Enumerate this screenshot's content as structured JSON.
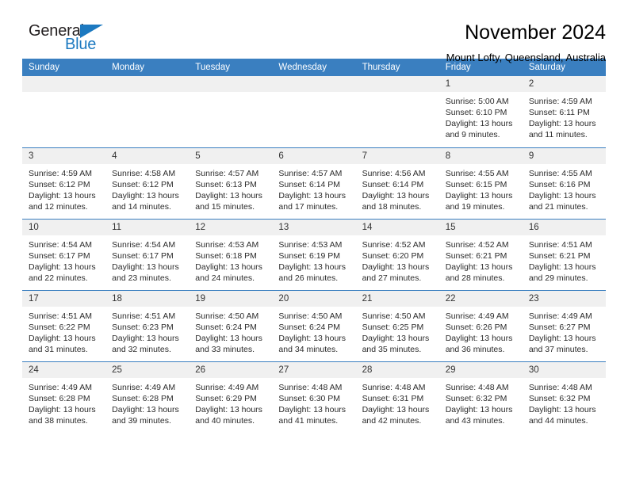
{
  "brand": {
    "name_top": "General",
    "name_bottom": "Blue",
    "accent_color": "#1c79c0",
    "triangle_icon": "brand-triangle-icon"
  },
  "header": {
    "title": "November 2024",
    "subtitle": "Mount Lofty, Queensland, Australia"
  },
  "colors": {
    "header_row_bg": "#3a7fc0",
    "header_row_text": "#ffffff",
    "daynum_bg": "#f0f0f0",
    "row_divider": "#3a7fc0"
  },
  "weekday_headers": [
    "Sunday",
    "Monday",
    "Tuesday",
    "Wednesday",
    "Thursday",
    "Friday",
    "Saturday"
  ],
  "labels": {
    "sunrise_prefix": "Sunrise:",
    "sunset_prefix": "Sunset:",
    "daylight_prefix": "Daylight:"
  },
  "weeks": [
    [
      {
        "day": "",
        "empty": true
      },
      {
        "day": "",
        "empty": true
      },
      {
        "day": "",
        "empty": true
      },
      {
        "day": "",
        "empty": true
      },
      {
        "day": "",
        "empty": true
      },
      {
        "day": "1",
        "sunrise": "Sunrise: 5:00 AM",
        "sunset": "Sunset: 6:10 PM",
        "daylight_line1": "Daylight: 13 hours",
        "daylight_line2": "and 9 minutes."
      },
      {
        "day": "2",
        "sunrise": "Sunrise: 4:59 AM",
        "sunset": "Sunset: 6:11 PM",
        "daylight_line1": "Daylight: 13 hours",
        "daylight_line2": "and 11 minutes."
      }
    ],
    [
      {
        "day": "3",
        "sunrise": "Sunrise: 4:59 AM",
        "sunset": "Sunset: 6:12 PM",
        "daylight_line1": "Daylight: 13 hours",
        "daylight_line2": "and 12 minutes."
      },
      {
        "day": "4",
        "sunrise": "Sunrise: 4:58 AM",
        "sunset": "Sunset: 6:12 PM",
        "daylight_line1": "Daylight: 13 hours",
        "daylight_line2": "and 14 minutes."
      },
      {
        "day": "5",
        "sunrise": "Sunrise: 4:57 AM",
        "sunset": "Sunset: 6:13 PM",
        "daylight_line1": "Daylight: 13 hours",
        "daylight_line2": "and 15 minutes."
      },
      {
        "day": "6",
        "sunrise": "Sunrise: 4:57 AM",
        "sunset": "Sunset: 6:14 PM",
        "daylight_line1": "Daylight: 13 hours",
        "daylight_line2": "and 17 minutes."
      },
      {
        "day": "7",
        "sunrise": "Sunrise: 4:56 AM",
        "sunset": "Sunset: 6:14 PM",
        "daylight_line1": "Daylight: 13 hours",
        "daylight_line2": "and 18 minutes."
      },
      {
        "day": "8",
        "sunrise": "Sunrise: 4:55 AM",
        "sunset": "Sunset: 6:15 PM",
        "daylight_line1": "Daylight: 13 hours",
        "daylight_line2": "and 19 minutes."
      },
      {
        "day": "9",
        "sunrise": "Sunrise: 4:55 AM",
        "sunset": "Sunset: 6:16 PM",
        "daylight_line1": "Daylight: 13 hours",
        "daylight_line2": "and 21 minutes."
      }
    ],
    [
      {
        "day": "10",
        "sunrise": "Sunrise: 4:54 AM",
        "sunset": "Sunset: 6:17 PM",
        "daylight_line1": "Daylight: 13 hours",
        "daylight_line2": "and 22 minutes."
      },
      {
        "day": "11",
        "sunrise": "Sunrise: 4:54 AM",
        "sunset": "Sunset: 6:17 PM",
        "daylight_line1": "Daylight: 13 hours",
        "daylight_line2": "and 23 minutes."
      },
      {
        "day": "12",
        "sunrise": "Sunrise: 4:53 AM",
        "sunset": "Sunset: 6:18 PM",
        "daylight_line1": "Daylight: 13 hours",
        "daylight_line2": "and 24 minutes."
      },
      {
        "day": "13",
        "sunrise": "Sunrise: 4:53 AM",
        "sunset": "Sunset: 6:19 PM",
        "daylight_line1": "Daylight: 13 hours",
        "daylight_line2": "and 26 minutes."
      },
      {
        "day": "14",
        "sunrise": "Sunrise: 4:52 AM",
        "sunset": "Sunset: 6:20 PM",
        "daylight_line1": "Daylight: 13 hours",
        "daylight_line2": "and 27 minutes."
      },
      {
        "day": "15",
        "sunrise": "Sunrise: 4:52 AM",
        "sunset": "Sunset: 6:21 PM",
        "daylight_line1": "Daylight: 13 hours",
        "daylight_line2": "and 28 minutes."
      },
      {
        "day": "16",
        "sunrise": "Sunrise: 4:51 AM",
        "sunset": "Sunset: 6:21 PM",
        "daylight_line1": "Daylight: 13 hours",
        "daylight_line2": "and 29 minutes."
      }
    ],
    [
      {
        "day": "17",
        "sunrise": "Sunrise: 4:51 AM",
        "sunset": "Sunset: 6:22 PM",
        "daylight_line1": "Daylight: 13 hours",
        "daylight_line2": "and 31 minutes."
      },
      {
        "day": "18",
        "sunrise": "Sunrise: 4:51 AM",
        "sunset": "Sunset: 6:23 PM",
        "daylight_line1": "Daylight: 13 hours",
        "daylight_line2": "and 32 minutes."
      },
      {
        "day": "19",
        "sunrise": "Sunrise: 4:50 AM",
        "sunset": "Sunset: 6:24 PM",
        "daylight_line1": "Daylight: 13 hours",
        "daylight_line2": "and 33 minutes."
      },
      {
        "day": "20",
        "sunrise": "Sunrise: 4:50 AM",
        "sunset": "Sunset: 6:24 PM",
        "daylight_line1": "Daylight: 13 hours",
        "daylight_line2": "and 34 minutes."
      },
      {
        "day": "21",
        "sunrise": "Sunrise: 4:50 AM",
        "sunset": "Sunset: 6:25 PM",
        "daylight_line1": "Daylight: 13 hours",
        "daylight_line2": "and 35 minutes."
      },
      {
        "day": "22",
        "sunrise": "Sunrise: 4:49 AM",
        "sunset": "Sunset: 6:26 PM",
        "daylight_line1": "Daylight: 13 hours",
        "daylight_line2": "and 36 minutes."
      },
      {
        "day": "23",
        "sunrise": "Sunrise: 4:49 AM",
        "sunset": "Sunset: 6:27 PM",
        "daylight_line1": "Daylight: 13 hours",
        "daylight_line2": "and 37 minutes."
      }
    ],
    [
      {
        "day": "24",
        "sunrise": "Sunrise: 4:49 AM",
        "sunset": "Sunset: 6:28 PM",
        "daylight_line1": "Daylight: 13 hours",
        "daylight_line2": "and 38 minutes."
      },
      {
        "day": "25",
        "sunrise": "Sunrise: 4:49 AM",
        "sunset": "Sunset: 6:28 PM",
        "daylight_line1": "Daylight: 13 hours",
        "daylight_line2": "and 39 minutes."
      },
      {
        "day": "26",
        "sunrise": "Sunrise: 4:49 AM",
        "sunset": "Sunset: 6:29 PM",
        "daylight_line1": "Daylight: 13 hours",
        "daylight_line2": "and 40 minutes."
      },
      {
        "day": "27",
        "sunrise": "Sunrise: 4:48 AM",
        "sunset": "Sunset: 6:30 PM",
        "daylight_line1": "Daylight: 13 hours",
        "daylight_line2": "and 41 minutes."
      },
      {
        "day": "28",
        "sunrise": "Sunrise: 4:48 AM",
        "sunset": "Sunset: 6:31 PM",
        "daylight_line1": "Daylight: 13 hours",
        "daylight_line2": "and 42 minutes."
      },
      {
        "day": "29",
        "sunrise": "Sunrise: 4:48 AM",
        "sunset": "Sunset: 6:32 PM",
        "daylight_line1": "Daylight: 13 hours",
        "daylight_line2": "and 43 minutes."
      },
      {
        "day": "30",
        "sunrise": "Sunrise: 4:48 AM",
        "sunset": "Sunset: 6:32 PM",
        "daylight_line1": "Daylight: 13 hours",
        "daylight_line2": "and 44 minutes."
      }
    ]
  ]
}
